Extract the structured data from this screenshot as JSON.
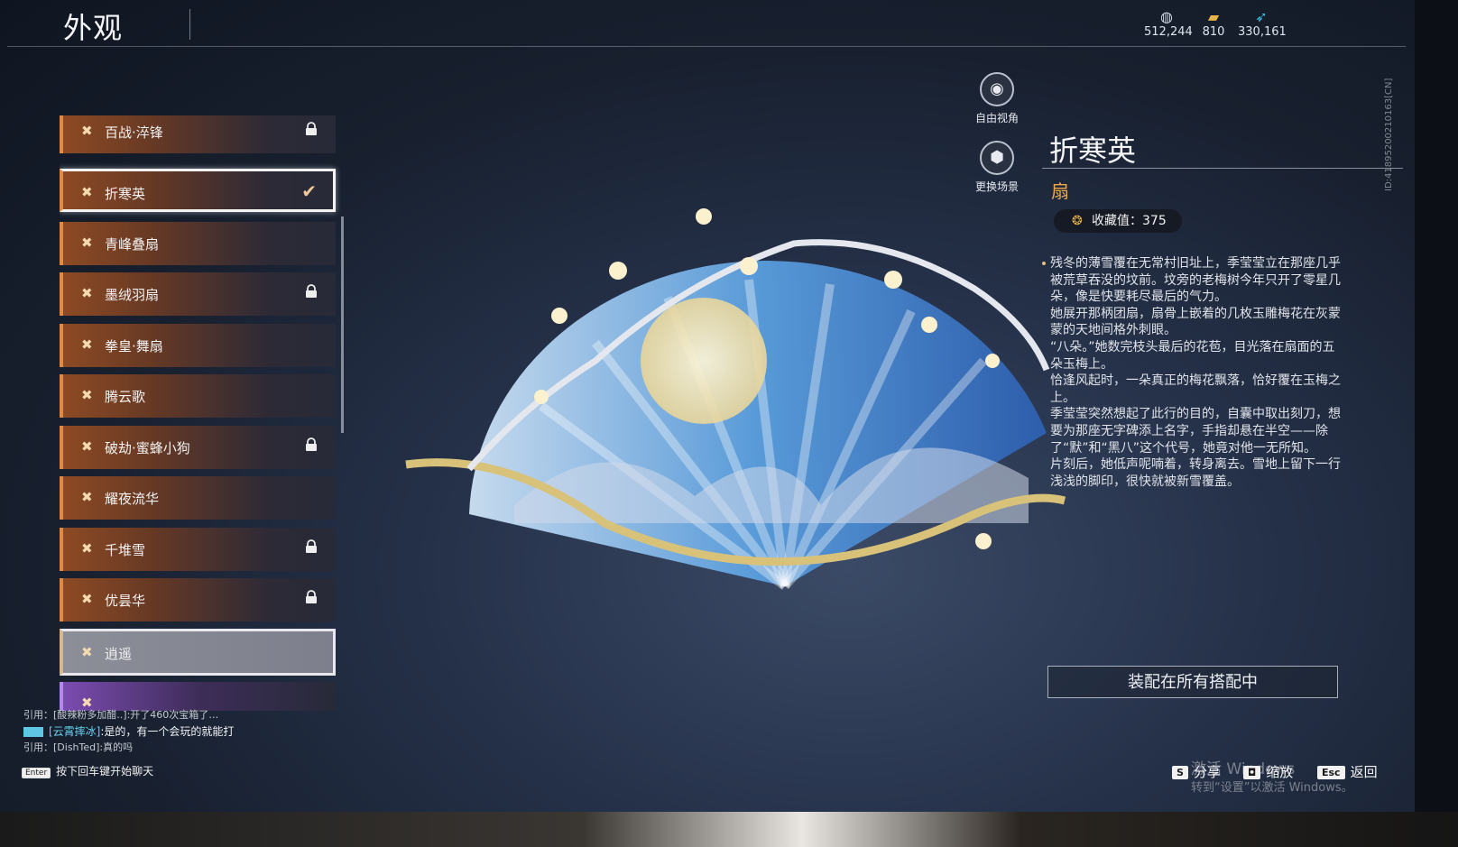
{
  "header": {
    "title": "外观",
    "currencies": [
      {
        "icon": "coin-icon",
        "value": "512,244"
      },
      {
        "icon": "ticket-icon",
        "value": "810"
      },
      {
        "icon": "feather-icon",
        "value": "330,161"
      }
    ]
  },
  "items": [
    {
      "label": "百战·淬锋",
      "locked": true,
      "state": "normal"
    },
    {
      "label": "折寒英",
      "locked": false,
      "state": "selected"
    },
    {
      "label": "青峰叠扇",
      "locked": false,
      "state": "normal"
    },
    {
      "label": "墨绒羽扇",
      "locked": true,
      "state": "normal"
    },
    {
      "label": "拳皇·舞扇",
      "locked": false,
      "state": "normal"
    },
    {
      "label": "腾云歌",
      "locked": false,
      "state": "normal"
    },
    {
      "label": "破劫·蜜蜂小狗",
      "locked": true,
      "state": "normal"
    },
    {
      "label": "耀夜流华",
      "locked": false,
      "state": "normal"
    },
    {
      "label": "千堆雪",
      "locked": true,
      "state": "normal"
    },
    {
      "label": "优昙华",
      "locked": true,
      "state": "normal"
    },
    {
      "label": "逍遥",
      "locked": false,
      "state": "hover"
    }
  ],
  "camera": {
    "free_view": "自由视角",
    "change_scene": "更换场景"
  },
  "detail": {
    "name": "折寒英",
    "type": "扇",
    "collect_value": "收藏值：375",
    "description": [
      "残冬的薄雪覆在无常村旧址上，季莹莹立在那座几乎被荒草吞没的坟前。坟旁的老梅树今年只开了零星几朵，像是快要耗尽最后的气力。",
      "她展开那柄团扇，扇骨上嵌着的几枚玉雕梅花在灰蒙蒙的天地间格外刺眼。",
      "“八朵。”她数完枝头最后的花苞，目光落在扇面的五朵玉梅上。",
      "恰逢风起时，一朵真正的梅花飘落，恰好覆在玉梅之上。",
      "季莹莹突然想起了此行的目的，自囊中取出刻刀，想要为那座无字碑添上名字，手指却悬在半空——除了“默”和“黑八”这个代号，她竟对他一无所知。",
      "片刻后，她低声呢喃着，转身离去。雪地上留下一行浅浅的脚印，很快就被新雪覆盖。"
    ],
    "equip_all": "装配在所有搭配中"
  },
  "chat": {
    "lines": [
      {
        "text": "引用：[酸辣粉多加醋..]:开了460次宝箱了…"
      },
      {
        "name": "[云霄摔冰]",
        "text": ":是的，有一个会玩的就能打"
      },
      {
        "text": "引用：[DishTed]:真的吗"
      }
    ],
    "hint_key": "Enter",
    "hint": "按下回车键开始聊天"
  },
  "hotkeys": [
    {
      "key": "S",
      "label": "分享"
    },
    {
      "key": "◘",
      "label": "缩放"
    },
    {
      "key": "Esc",
      "label": "返回"
    }
  ],
  "watermark": {
    "line1": "激活 Windows",
    "line2": "转到“设置”以激活 Windows。"
  },
  "build_id": "ID:4189520021016​3[CN]"
}
